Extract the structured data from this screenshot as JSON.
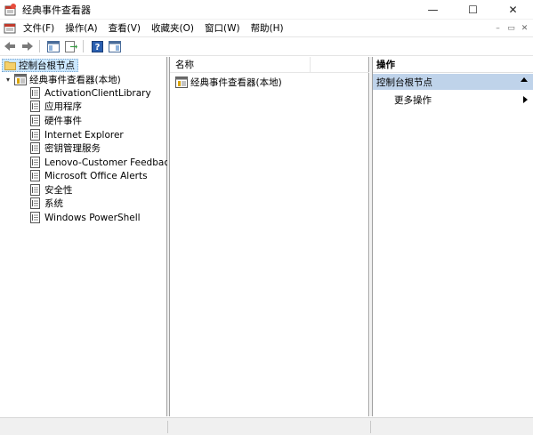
{
  "window": {
    "title": "经典事件查看器",
    "minimize": "—",
    "maximize": "☐",
    "close": "✕"
  },
  "menu": {
    "items": [
      "文件(F)",
      "操作(A)",
      "查看(V)",
      "收藏夹(O)",
      "窗口(W)",
      "帮助(H)"
    ],
    "mdi_minimize": "–",
    "mdi_restore": "▭",
    "mdi_close": "✕"
  },
  "tree": {
    "root": "控制台根节点",
    "viewer": "经典事件查看器(本地)",
    "logs": [
      "ActivationClientLibrary",
      "应用程序",
      "硬件事件",
      "Internet Explorer",
      "密钥管理服务",
      "Lenovo-Customer Feedback",
      "Microsoft Office Alerts",
      "安全性",
      "系统",
      "Windows PowerShell"
    ]
  },
  "middle": {
    "column_name": "名称",
    "row": "经典事件查看器(本地)"
  },
  "actions": {
    "header": "操作",
    "section": "控制台根节点",
    "item": "更多操作"
  },
  "colors": {
    "selection": "#cce8ff",
    "section_bg": "#bfd3ea",
    "border": "#a0a0a0"
  }
}
